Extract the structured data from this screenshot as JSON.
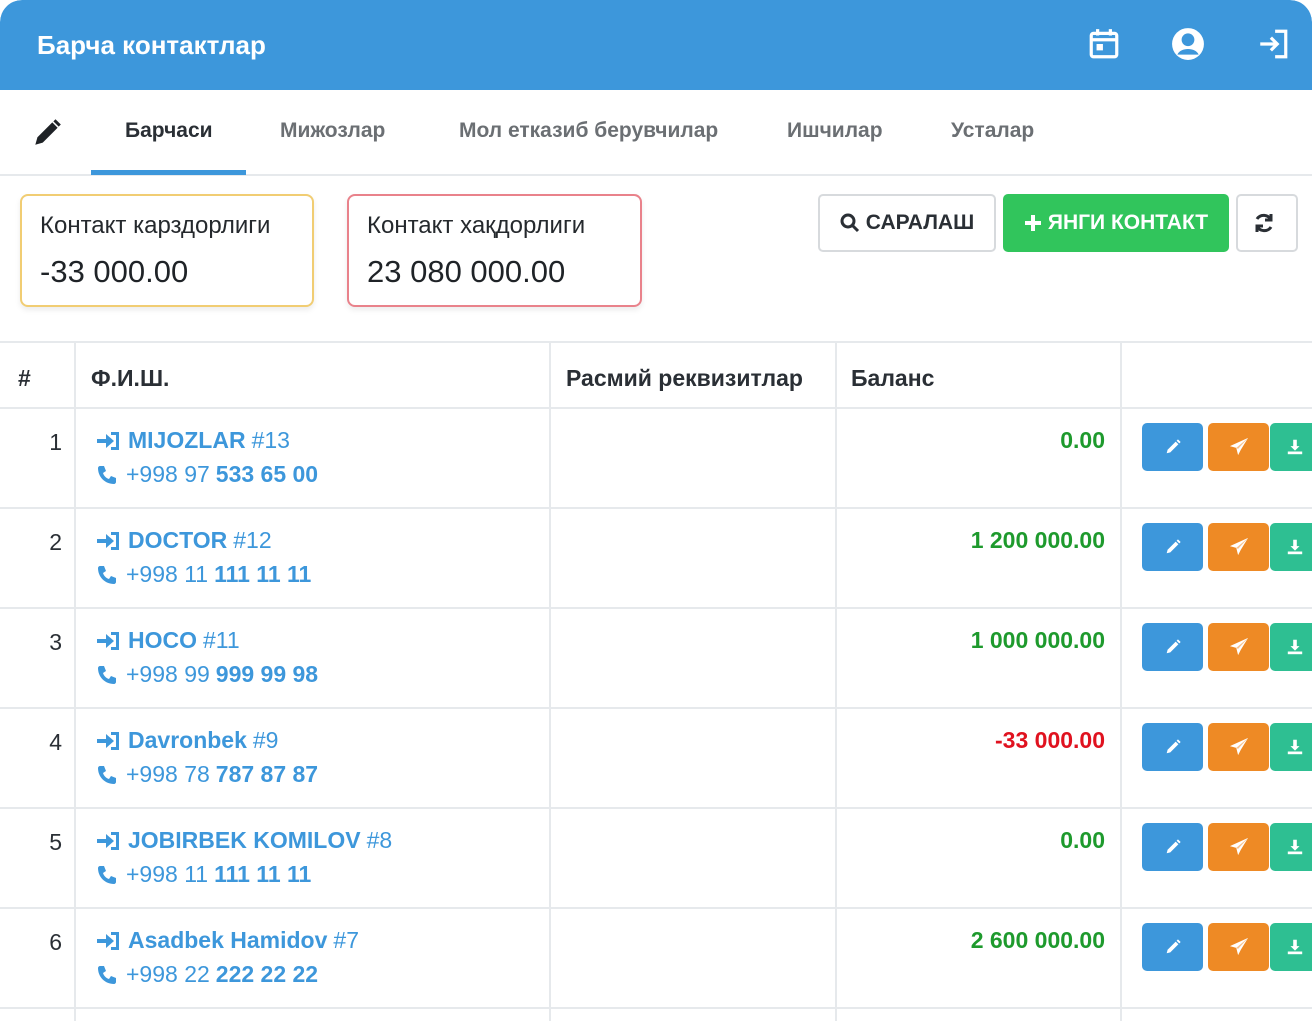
{
  "header": {
    "title": "Барча контактлар",
    "icons": [
      "calendar-icon",
      "user-circle-icon",
      "sign-out-icon"
    ],
    "color": "#3d97db"
  },
  "tabs": [
    {
      "label": "Барчаси",
      "active": true
    },
    {
      "label": "Мижозлар",
      "active": false
    },
    {
      "label": "Мол етказиб берувчилар",
      "active": false
    },
    {
      "label": "Ишчилар",
      "active": false
    },
    {
      "label": "Усталар",
      "active": false
    }
  ],
  "summary": {
    "debt": {
      "label": "Контакт карздорлиги",
      "value": "-33 000.00"
    },
    "credit": {
      "label": "Контакт хақдорлиги",
      "value": "23 080 000.00"
    }
  },
  "actions": {
    "search_label": "САРАЛАШ",
    "new_label": "ЯНГИ КОНТАКТ",
    "new_color": "#31c55c"
  },
  "table": {
    "columns": [
      "#",
      "Ф.И.Ш.",
      "Расмий реквизитлар",
      "Баланс"
    ],
    "rows": [
      {
        "num": "1",
        "name": "MIJOZLAR",
        "id": "#13",
        "phone_prefix": "+998 97",
        "phone_number": "533 65 00",
        "requisites": "",
        "balance": "0.00",
        "balance_sign": "pos"
      },
      {
        "num": "2",
        "name": "DOCTOR",
        "id": "#12",
        "phone_prefix": "+998 11",
        "phone_number": "111 11 11",
        "requisites": "",
        "balance": "1 200 000.00",
        "balance_sign": "pos"
      },
      {
        "num": "3",
        "name": "HOCO",
        "id": "#11",
        "phone_prefix": "+998 99",
        "phone_number": "999 99 98",
        "requisites": "",
        "balance": "1 000 000.00",
        "balance_sign": "pos"
      },
      {
        "num": "4",
        "name": "Davronbek",
        "id": "#9",
        "phone_prefix": "+998 78",
        "phone_number": "787 87 87",
        "requisites": "",
        "balance": "-33 000.00",
        "balance_sign": "neg"
      },
      {
        "num": "5",
        "name": "JOBIRBEK KOMILOV",
        "id": "#8",
        "phone_prefix": "+998 11",
        "phone_number": "111 11 11",
        "requisites": "",
        "balance": "0.00",
        "balance_sign": "pos"
      },
      {
        "num": "6",
        "name": "Asadbek Hamidov",
        "id": "#7",
        "phone_prefix": "+998 22",
        "phone_number": "222 22 22",
        "requisites": "",
        "balance": "2 600 000.00",
        "balance_sign": "pos"
      }
    ]
  }
}
